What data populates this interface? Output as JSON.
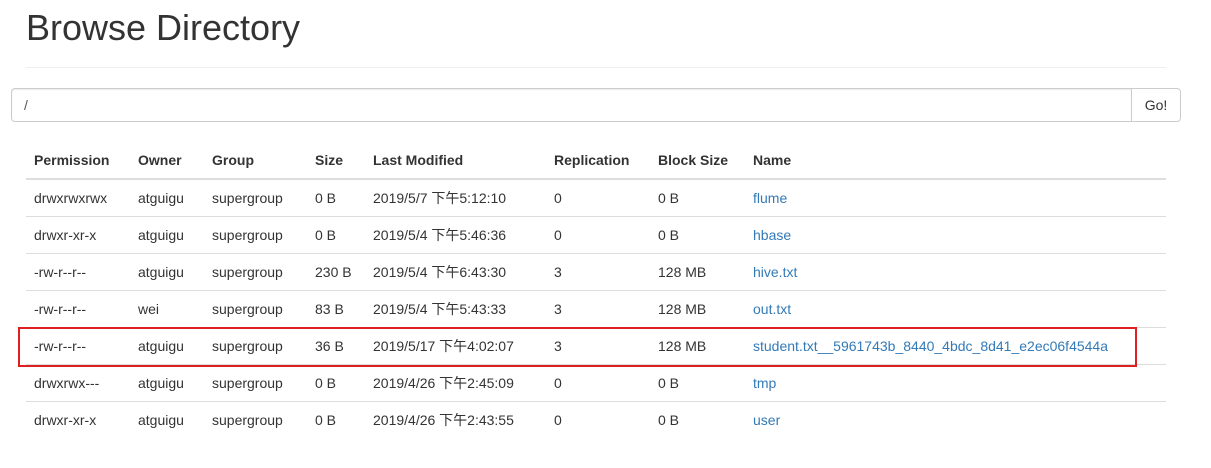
{
  "page": {
    "title": "Browse Directory"
  },
  "path_bar": {
    "value": "/",
    "go_label": "Go!"
  },
  "table": {
    "headers": {
      "permission": "Permission",
      "owner": "Owner",
      "group": "Group",
      "size": "Size",
      "last_modified": "Last Modified",
      "replication": "Replication",
      "block_size": "Block Size",
      "name": "Name"
    },
    "rows": [
      {
        "permission": "drwxrwxrwx",
        "owner": "atguigu",
        "group": "supergroup",
        "size": "0 B",
        "last_modified": "2019/5/7 下午5:12:10",
        "replication": "0",
        "block_size": "0 B",
        "name": "flume"
      },
      {
        "permission": "drwxr-xr-x",
        "owner": "atguigu",
        "group": "supergroup",
        "size": "0 B",
        "last_modified": "2019/5/4 下午5:46:36",
        "replication": "0",
        "block_size": "0 B",
        "name": "hbase"
      },
      {
        "permission": "-rw-r--r--",
        "owner": "atguigu",
        "group": "supergroup",
        "size": "230 B",
        "last_modified": "2019/5/4 下午6:43:30",
        "replication": "3",
        "block_size": "128 MB",
        "name": "hive.txt"
      },
      {
        "permission": "-rw-r--r--",
        "owner": "wei",
        "group": "supergroup",
        "size": "83 B",
        "last_modified": "2019/5/4 下午5:43:33",
        "replication": "3",
        "block_size": "128 MB",
        "name": "out.txt"
      },
      {
        "permission": "-rw-r--r--",
        "owner": "atguigu",
        "group": "supergroup",
        "size": "36 B",
        "last_modified": "2019/5/17 下午4:02:07",
        "replication": "3",
        "block_size": "128 MB",
        "name": "student.txt__5961743b_8440_4bdc_8d41_e2ec06f4544a"
      },
      {
        "permission": "drwxrwx---",
        "owner": "atguigu",
        "group": "supergroup",
        "size": "0 B",
        "last_modified": "2019/4/26 下午2:45:09",
        "replication": "0",
        "block_size": "0 B",
        "name": "tmp"
      },
      {
        "permission": "drwxr-xr-x",
        "owner": "atguigu",
        "group": "supergroup",
        "size": "0 B",
        "last_modified": "2019/4/26 下午2:43:55",
        "replication": "0",
        "block_size": "0 B",
        "name": "user"
      }
    ]
  },
  "colors": {
    "link": "#337ab7",
    "highlight_border": "#e02020",
    "text": "#333333",
    "rule": "#dddddd"
  }
}
